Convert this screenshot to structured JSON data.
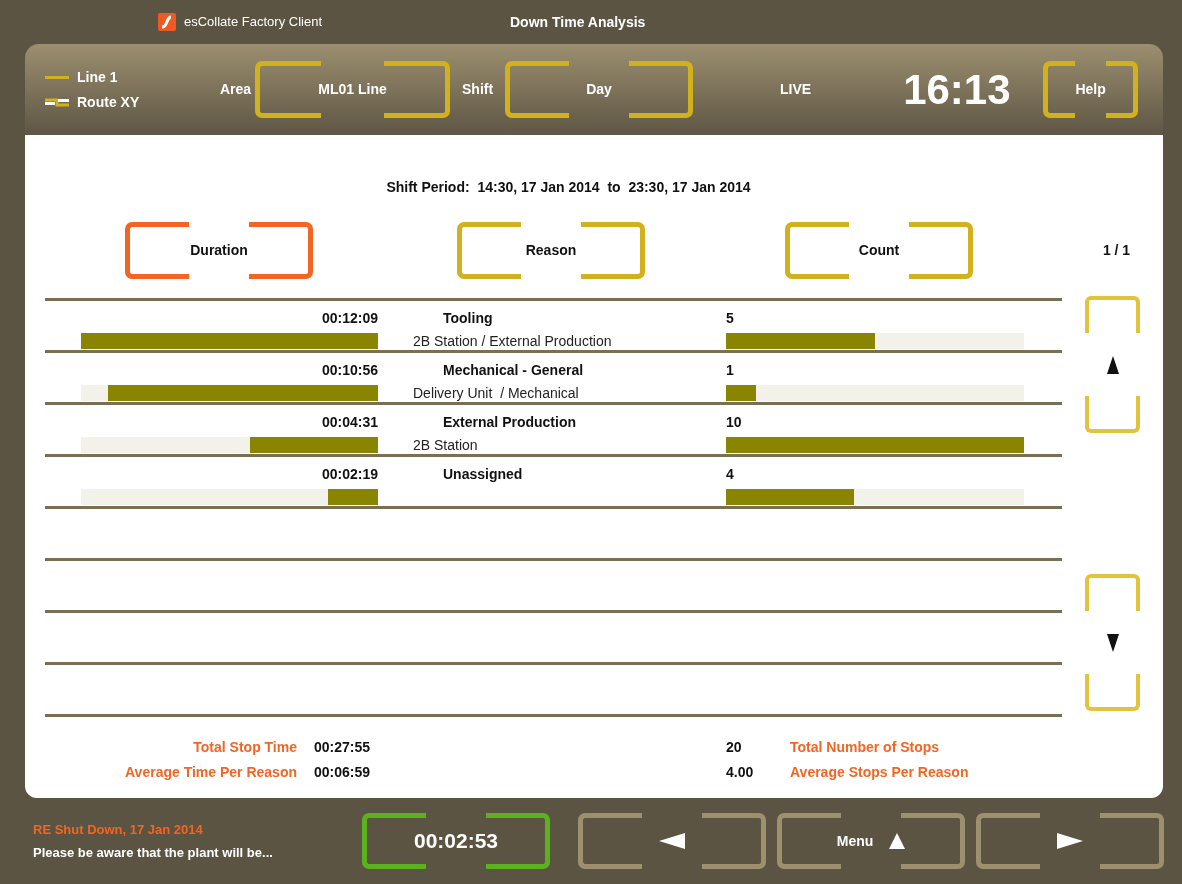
{
  "title_bar": {
    "app_name": "esCollate Factory Client",
    "screen_title": "Down Time Analysis"
  },
  "header": {
    "line": "Line 1",
    "route": "Route XY",
    "area_label": "Area",
    "area": "ML01 Line",
    "shift_label": "Shift",
    "shift": "Day",
    "mode": "LIVE",
    "clock": "16:13",
    "help": "Help"
  },
  "shift_period": "Shift Period:  14:30, 17 Jan 2014  to  23:30, 17 Jan 2014",
  "sort_buttons": [
    {
      "label": "Duration",
      "selected": true
    },
    {
      "label": "Reason",
      "selected": false
    },
    {
      "label": "Count",
      "selected": false
    }
  ],
  "page": "1 / 1",
  "rows": [
    {
      "duration": {
        "text": "00:12:09",
        "level": 1
      },
      "reason": "Tooling",
      "detail": "2B Station / External Production",
      "count": {
        "text": "5",
        "level": 0.5
      }
    },
    {
      "duration": {
        "text": "00:10:56",
        "level": 0.91
      },
      "reason": "Mechanical - General",
      "detail": "Delivery Unit  / Mechanical",
      "count": {
        "text": "1",
        "level": 0.1
      }
    },
    {
      "duration": {
        "text": "00:04:31",
        "level": 0.43
      },
      "reason": "External Production",
      "detail": "2B Station",
      "count": {
        "text": "10",
        "level": 1
      }
    },
    {
      "duration": {
        "text": "00:02:19",
        "level": 0.17
      },
      "reason": "Unassigned",
      "count": {
        "text": "4",
        "level": 0.43
      }
    }
  ],
  "time_totals": [
    {
      "label": "Total Stop Time",
      "value": "00:27:55"
    },
    {
      "label": "Average Time Per Reason",
      "value": "00:06:59"
    }
  ],
  "count_totals": [
    {
      "value": "20",
      "label": "Total Number of Stops"
    },
    {
      "value": "4.00",
      "label": "Average Stops Per Reason"
    }
  ],
  "footer": {
    "message_title": "RE Shut Down, 17 Jan 2014",
    "message": "Please be aware that the plant will be...",
    "timer": "00:02:53",
    "nav": [
      {
        "kind": "prev"
      },
      {
        "kind": "menu",
        "label": "Menu"
      },
      {
        "kind": "next"
      }
    ]
  }
}
